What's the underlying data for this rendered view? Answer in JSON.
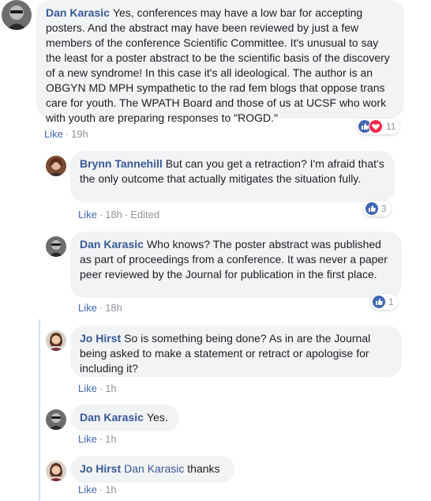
{
  "comments": [
    {
      "author": "Dan Karasic",
      "text": "Yes, conferences may have a low bar for accepting posters. And the abstract may have been reviewed by just a few members of the conference Scientific Committee. It's unusual to say the least for a poster abstract to be the scientific basis of the discovery of a new syndrome! In this case it's all ideological. The author is an OBGYN MD MPH sympathetic to the rad fem blogs that oppose trans care for youth. The WPATH Board and those of us at UCSF who work with youth are preparing responses to \"ROGD.\"",
      "like": "Like",
      "time": "19h",
      "reaction_count": "11",
      "reactions": [
        "like",
        "love"
      ]
    },
    {
      "author": "Brynn Tannehill",
      "text": "But can you get a retraction? I'm afraid that's the only outcome that actually mitigates the situation fully.",
      "like": "Like",
      "time": "18h",
      "edited": "Edited",
      "reaction_count": "3",
      "reactions": [
        "like"
      ]
    },
    {
      "author": "Dan Karasic",
      "text": "Who knows? The poster abstract was published as part of proceedings from a conference. It was never a paper peer reviewed by the Journal for publication in the first place.",
      "like": "Like",
      "time": "18h",
      "reaction_count": "1",
      "reactions": [
        "like"
      ]
    },
    {
      "author": "Jo Hirst",
      "text": "So is something being done? As in are the Journal being asked to make a statement or retract or apologise for including it?",
      "like": "Like",
      "time": "1h"
    },
    {
      "author": "Dan Karasic",
      "text": "Yes.",
      "like": "Like",
      "time": "1h"
    },
    {
      "author": "Jo Hirst",
      "mention": "Dan Karasic",
      "text": "thanks",
      "like": "Like",
      "time": "1h"
    }
  ],
  "separator": "·",
  "colors": {
    "link": "#385898",
    "like_blue": "#4267b2",
    "bubble": "#f2f3f5",
    "meta": "#90949c",
    "love_red": "#f0284a"
  }
}
